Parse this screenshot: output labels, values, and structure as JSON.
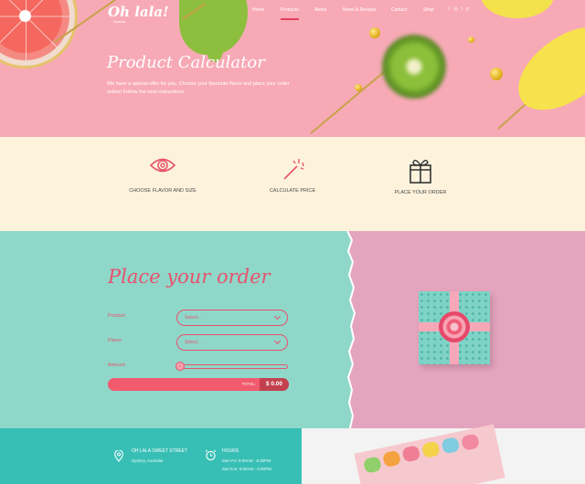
{
  "brand": {
    "logo": "Oh lala!",
    "tagline": "Sweets"
  },
  "nav": {
    "items": [
      "Home",
      "Products",
      "About",
      "News & Recipes",
      "Contact",
      "Shop"
    ],
    "active_index": 1,
    "socials": [
      "f",
      "◎",
      "t",
      "p"
    ]
  },
  "hero": {
    "title": "Product Calculator",
    "description": "We have a special offer for you. Choose your favourite flavor and place your order online! Follow the next instructions."
  },
  "steps": [
    {
      "icon": "eye-icon",
      "label": "CHOOSE FLAVOR AND SIZE"
    },
    {
      "icon": "magic-wand-icon",
      "label": "CALCULATE PRICE"
    },
    {
      "icon": "gift-icon",
      "label": "PLACE YOUR ORDER"
    }
  ],
  "order": {
    "title": "Place your order",
    "product_label": "Product",
    "product_placeholder": "Select...",
    "flavor_label": "Flavor",
    "flavor_placeholder": "Select...",
    "amount_label": "Amount",
    "amount_value": "1",
    "total_label": "TOTAL:",
    "total_value": "$ 0.00"
  },
  "footer": {
    "address_head": "OH LALA SWEET STREET",
    "address_line": "Sydney, Australia",
    "hours_head": "HOURS",
    "hours_line1": "Mon-Fri: 8:00AM - 6:30PM",
    "hours_line2": "Sat-Sun: 9:00AM - 5:00PM"
  },
  "colors": {
    "accent": "#e8526c",
    "hero_bg": "#f7aab6",
    "steps_bg": "#fdf3dc",
    "order_bg": "#8fd7c9",
    "footer_bg": "#38bfb5"
  }
}
